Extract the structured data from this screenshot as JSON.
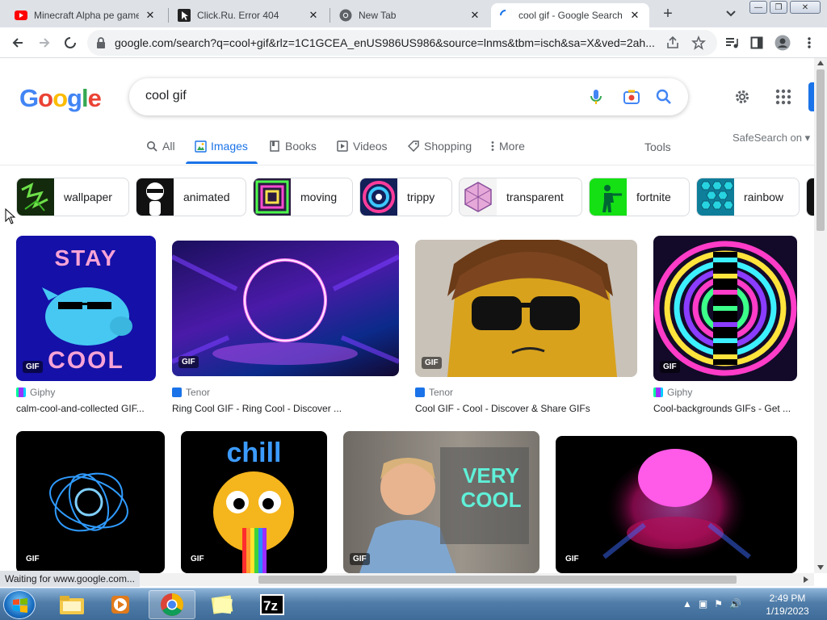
{
  "browser": {
    "tabs": [
      {
        "title": "Minecraft Alpha pe game",
        "favicon": "youtube-icon"
      },
      {
        "title": "Click.Ru. Error 404",
        "favicon": "cursor-icon"
      },
      {
        "title": "New Tab",
        "favicon": "chrome-icon"
      },
      {
        "title": "cool gif - Google Search",
        "favicon": "loading-spinner-icon"
      }
    ],
    "new_tab_label": "+",
    "url": "google.com/search?q=cool+gif&rlz=1C1GCEA_enUS986US986&source=lnms&tbm=isch&sa=X&ved=2ah..."
  },
  "search": {
    "logo": "Google",
    "query": "cool gif"
  },
  "nav": {
    "items": [
      {
        "label": "All",
        "icon": "search-icon"
      },
      {
        "label": "Images",
        "icon": "image-icon"
      },
      {
        "label": "Books",
        "icon": "book-icon"
      },
      {
        "label": "Videos",
        "icon": "video-icon"
      },
      {
        "label": "Shopping",
        "icon": "tag-icon"
      },
      {
        "label": "More",
        "icon": "more-vert-icon"
      }
    ],
    "tools": "Tools",
    "safesearch": "SafeSearch on ▾"
  },
  "chips": [
    {
      "label": "wallpaper",
      "color": "#1b3a12"
    },
    {
      "label": "animated",
      "color": "#111111"
    },
    {
      "label": "moving",
      "color": "#2a1a40"
    },
    {
      "label": "trippy",
      "color": "#1b2c6a"
    },
    {
      "label": "transparent",
      "color": "#e9d7ee"
    },
    {
      "label": "fortnite",
      "color": "#22dd22"
    },
    {
      "label": "rainbow",
      "color": "#1fb3c8"
    }
  ],
  "results": [
    {
      "source": "Giphy",
      "caption": "calm-cool-and-collected GIF...",
      "badge": "GIF",
      "overlay": [
        "STAY",
        "COOL"
      ]
    },
    {
      "source": "Tenor",
      "caption": "Ring Cool GIF - Ring Cool - Discover ...",
      "badge": "GIF"
    },
    {
      "source": "Tenor",
      "caption": "Cool GIF - Cool - Discover & Share GIFs",
      "badge": "GIF"
    },
    {
      "source": "Giphy",
      "caption": "Cool-backgrounds GIFs - Get ...",
      "badge": "GIF"
    },
    {
      "badge": "GIF"
    },
    {
      "badge": "GIF",
      "overlay": [
        "chill"
      ]
    },
    {
      "badge": "GIF",
      "overlay": [
        "VERY",
        "COOL"
      ]
    },
    {
      "badge": "GIF"
    }
  ],
  "status": "Waiting for www.google.com...",
  "taskbar": {
    "time": "2:49 PM",
    "date": "1/19/2023"
  },
  "colors": {
    "accent": "#1a73e8",
    "tabstrip": "#dee1e6"
  }
}
